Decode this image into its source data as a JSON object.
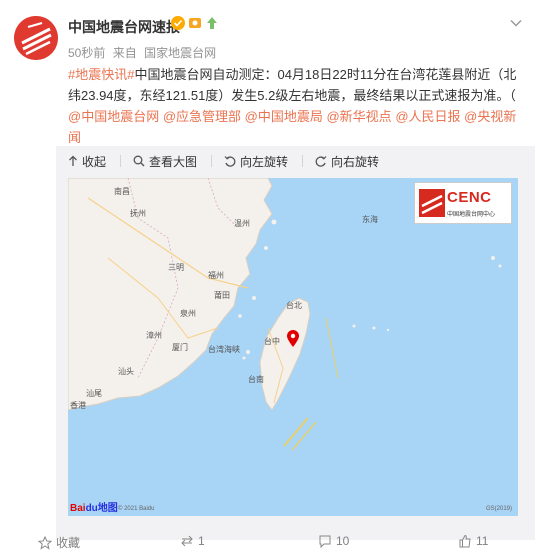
{
  "account": {
    "name": "中国地震台网速报",
    "time": "50秒前",
    "source_prefix": "来自",
    "source": "国家地震台网"
  },
  "post": {
    "hashtag": "#地震快讯#",
    "body": "中国地震台网自动测定：04月18日22时11分在台湾花莲县附近（北纬23.94度，东经121.51度）发生5.2级左右地震，最终结果以正式速报为准。（",
    "mentions": [
      "@中国地震台网",
      "@应急管理部",
      "@中国地震局",
      "@新华视点",
      "@人民日报",
      "@央视新闻"
    ],
    "close": "）"
  },
  "toolbar": {
    "collapse": "收起",
    "view_large": "查看大图",
    "rotate_left": "向左旋转",
    "rotate_right": "向右旋转"
  },
  "map": {
    "logo_title": "CENC",
    "logo_subtitle": "中国地震台网中心",
    "provider": "Bai",
    "provider_suffix": "du地图",
    "copyright": "© 2021 Baidu",
    "gs": "GS(2019)",
    "labels": {
      "nanchang": "南昌",
      "fuzhou_jx": "抚州",
      "wenzhou": "温州",
      "sanming": "三明",
      "fuzhou": "福州",
      "putian": "莆田",
      "quanzhou": "泉州",
      "zhangzhou": "漳州",
      "xiamen": "厦门",
      "shantou": "汕头",
      "shanwei": "汕尾",
      "xianggang": "香港",
      "taipei": "台北",
      "taizhong": "台中",
      "tainan": "台南",
      "strait": "台湾海峡",
      "east_sea": "东海"
    }
  },
  "actions": {
    "fav": "收藏",
    "repost": "1",
    "comment": "10",
    "like": "11"
  },
  "colors": {
    "accent": "#eb7350",
    "avatar": "#e03a30",
    "epicenter": "#e00000",
    "sea": "#a8d4f6",
    "land": "#f4f1ec"
  }
}
